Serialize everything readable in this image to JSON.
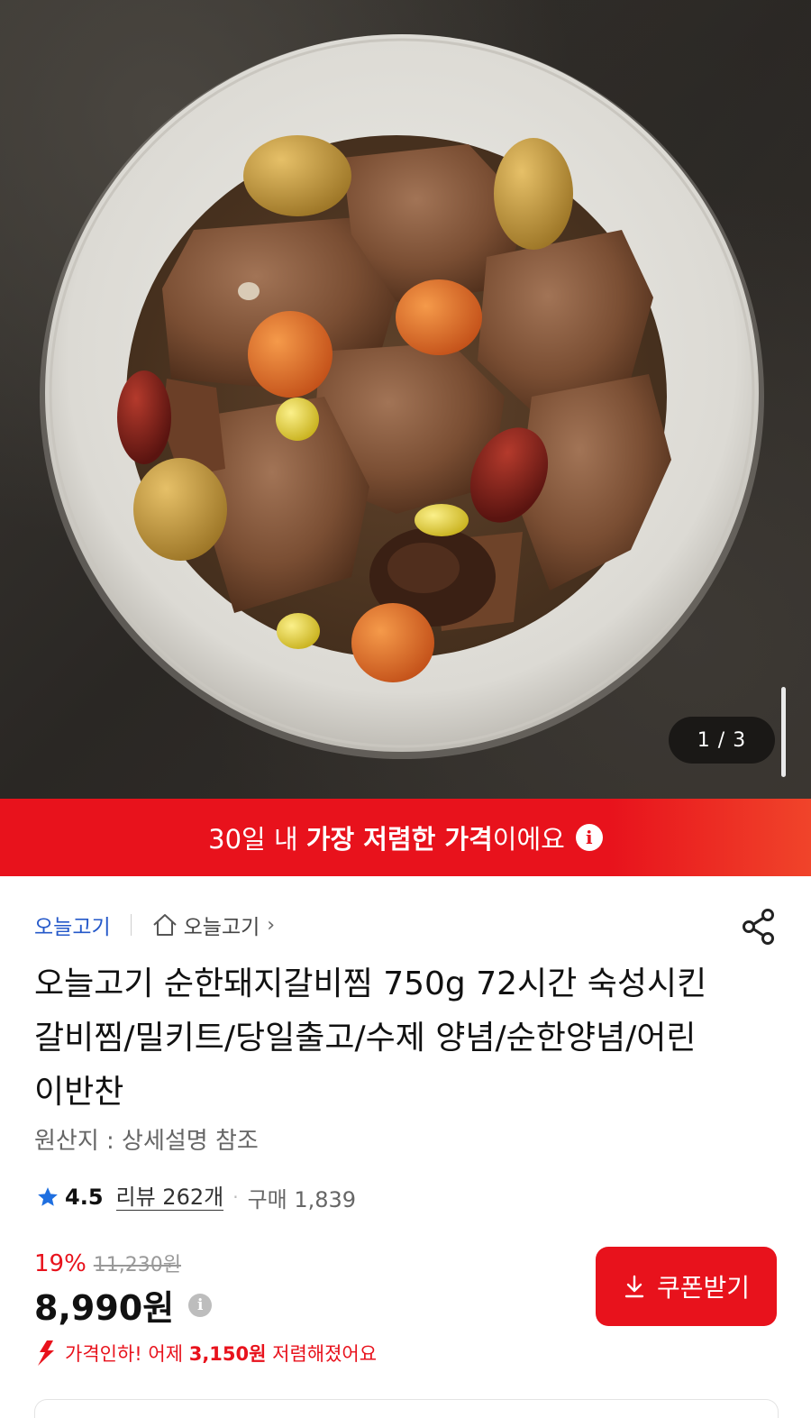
{
  "gallery": {
    "counter": "1 / 3"
  },
  "banner": {
    "text_before": "30일 내 ",
    "text_highlight": "가장 저렴한 가격",
    "text_after": "이에요",
    "info_icon": "info-icon"
  },
  "breadcrumb": {
    "brand": "오늘고기",
    "store": "오늘고기",
    "store_icon": "home-icon",
    "chevron": "›"
  },
  "product": {
    "title": "오늘고기 순한돼지갈비찜 750g 72시간 숙성시킨 갈비찜/밀키트/당일출고/수제 양념/순한양념/어린이반찬",
    "origin": "원산지 : 상세설명 참조",
    "rating": "4.5",
    "reviews": "리뷰 262개",
    "purchases": "구매 1,839",
    "discount": "19%",
    "original_price": "11,230원",
    "price": "8,990원",
    "price_drop_prefix": "가격인하! 어제 ",
    "price_drop_amount": "3,150원",
    "price_drop_suffix": " 저렴해졌어요"
  },
  "actions": {
    "coupon_label": "쿠폰받기",
    "share_icon": "share-icon",
    "download_icon": "download-icon"
  },
  "colors": {
    "accent": "#e8121c",
    "link": "#2458c9",
    "star": "#1f6fe0"
  }
}
